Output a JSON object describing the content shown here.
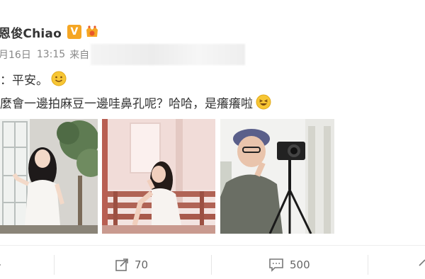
{
  "post": {
    "author": "恩俊Chiao",
    "verified_badge": "V",
    "date": "月16日",
    "time": "13:15",
    "source_prefix": "来自",
    "line1_text": "：平安。",
    "line2_text": "麼會一邊拍麻豆一邊哇鼻孔呢？哈哈，是癢癢啦",
    "images": [
      {
        "name": "photo-woman-window"
      },
      {
        "name": "photo-woman-bench"
      },
      {
        "name": "photo-man-camera"
      }
    ]
  },
  "actions": {
    "share_count": "70",
    "comment_count": "500"
  },
  "colors": {
    "badge": "#f5a623",
    "emoji": "#f7c634",
    "text": "#333333",
    "meta": "#888888"
  },
  "icons": [
    "share-icon",
    "comment-icon",
    "smile-emoji-icon",
    "laugh-emoji-icon",
    "member-icon"
  ]
}
